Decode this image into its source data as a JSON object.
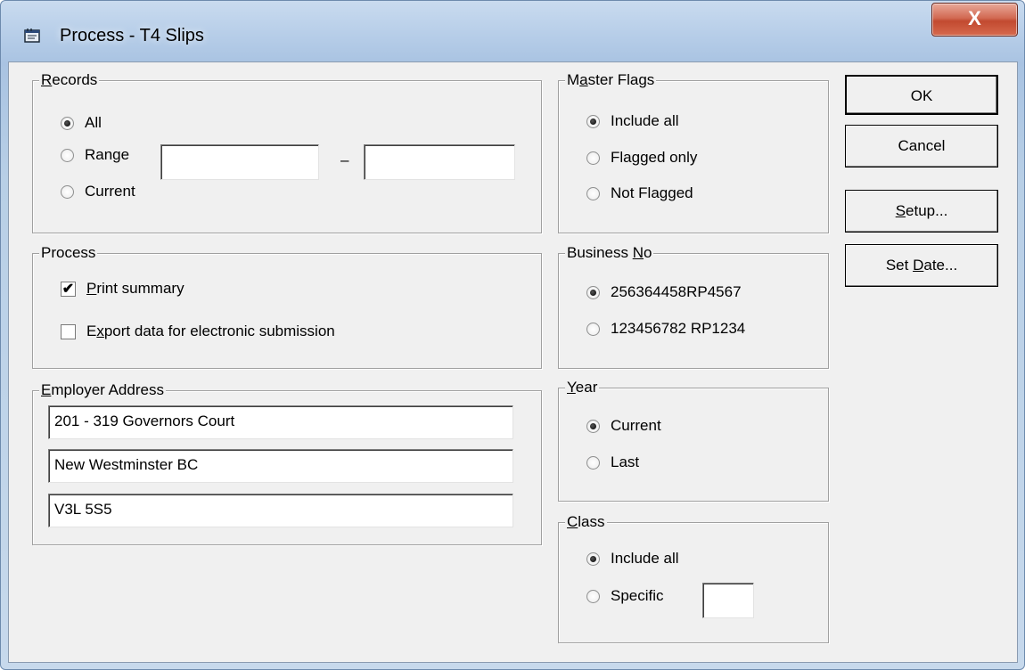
{
  "window": {
    "title": "Process - T4 Slips",
    "close_label": "X"
  },
  "records": {
    "title_u": "R",
    "title_rest": "ecords",
    "opt_all": "All",
    "opt_range": "Range",
    "opt_current": "Current",
    "range_from": "",
    "range_to": "",
    "range_sep": "–",
    "selected": "All"
  },
  "process": {
    "title": "Process",
    "print_summary_u": "P",
    "print_summary_rest": "rint summary",
    "print_summary_checked": true,
    "export_pre": "E",
    "export_u": "x",
    "export_rest": "port data for electronic submission",
    "export_checked": false
  },
  "employer": {
    "title_u": "E",
    "title_rest": "mployer Address",
    "line1": "201 - 319 Governors Court",
    "line2": "New Westminster BC",
    "line3": "V3L 5S5"
  },
  "master_flags": {
    "title_pre": "M",
    "title_u": "a",
    "title_rest": "ster Flags",
    "opt_include_all": "Include all",
    "opt_flagged_only": "Flagged only",
    "opt_not_flagged": "Not Flagged",
    "selected": "Include all"
  },
  "business_no": {
    "title_pre": "Business ",
    "title_u": "N",
    "title_rest": "o",
    "opt_1": "256364458RP4567",
    "opt_2": "123456782 RP1234",
    "selected": "256364458RP4567"
  },
  "year": {
    "title_u": "Y",
    "title_rest": "ear",
    "opt_current": "Current",
    "opt_last": "Last",
    "selected": "Current"
  },
  "class": {
    "title_u": "C",
    "title_rest": "lass",
    "opt_include_all": "Include all",
    "opt_specific": "Specific",
    "specific_value": "",
    "selected": "Include all"
  },
  "buttons": {
    "ok": "OK",
    "cancel": "Cancel",
    "setup_u": "S",
    "setup_rest": "etup...",
    "setdate_pre": "Set ",
    "setdate_u": "D",
    "setdate_rest": "ate..."
  }
}
